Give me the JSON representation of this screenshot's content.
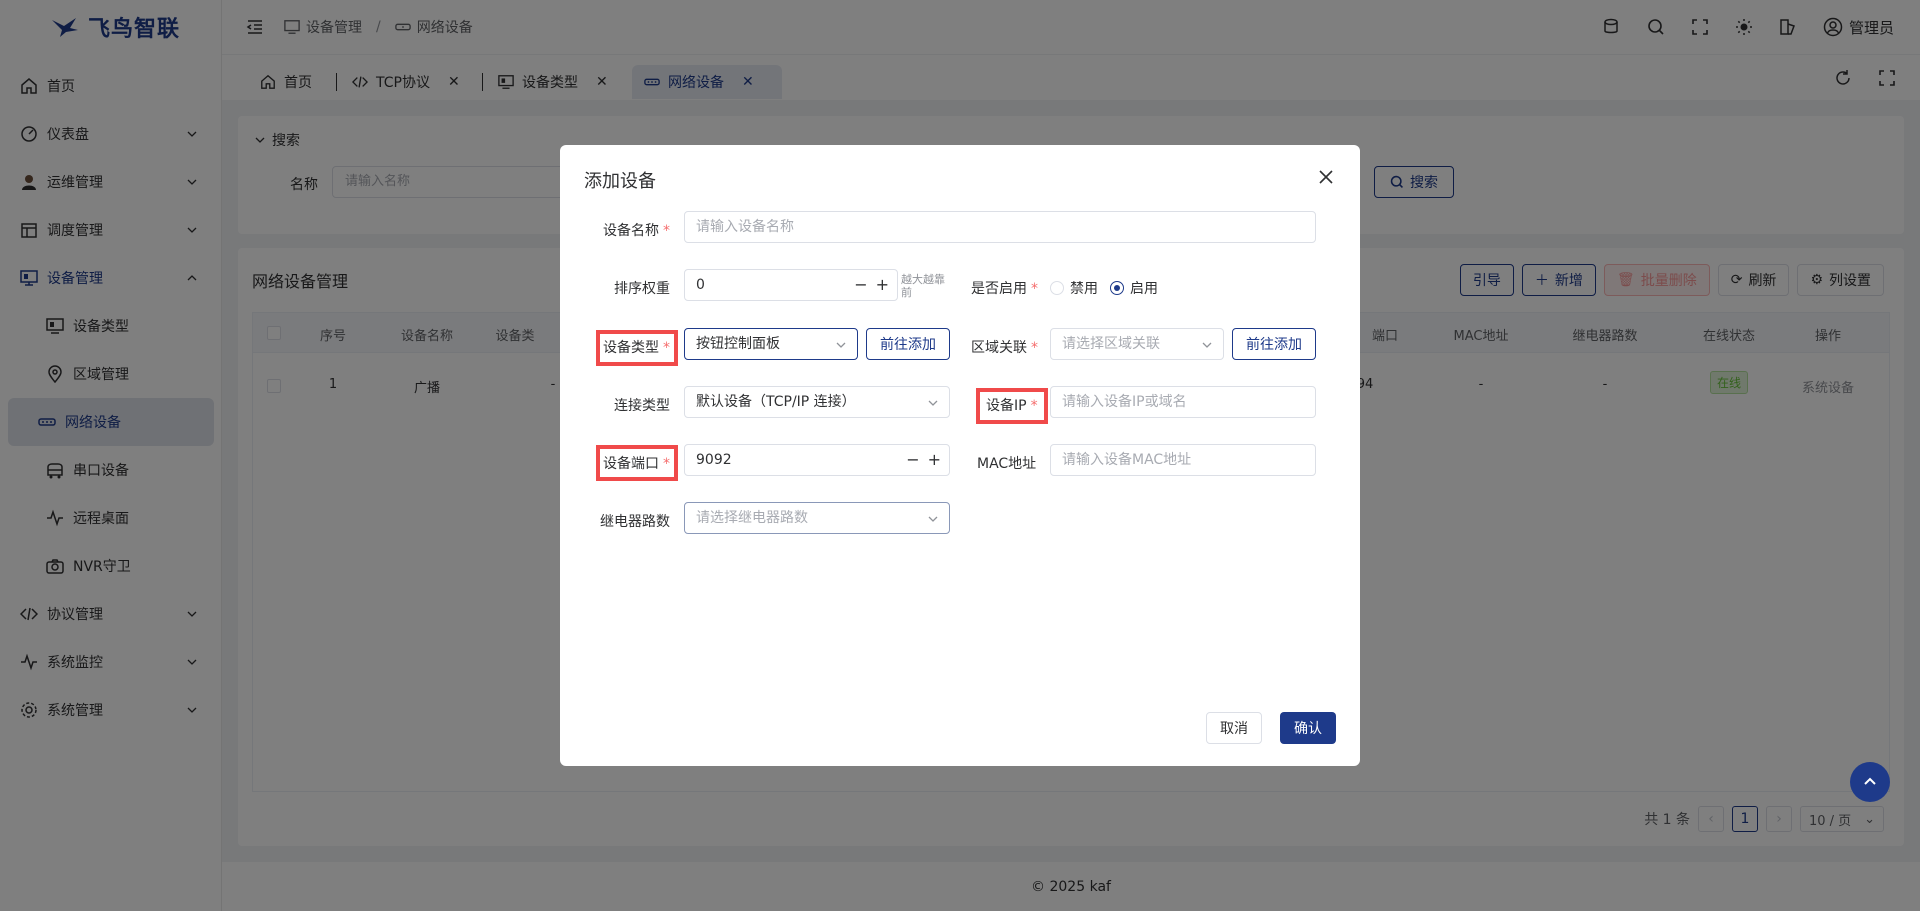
{
  "app": {
    "name": "飞鸟智联"
  },
  "sidebar": {
    "items": [
      {
        "label": "首页",
        "icon": "home-icon"
      },
      {
        "label": "仪表盘",
        "icon": "dashboard-icon"
      },
      {
        "label": "运维管理",
        "icon": "user-icon"
      },
      {
        "label": "调度管理",
        "icon": "calendar-icon"
      },
      {
        "label": "设备管理",
        "icon": "monitor-icon"
      },
      {
        "label": "协议管理",
        "icon": "code-icon"
      },
      {
        "label": "系统监控",
        "icon": "pulse-icon"
      },
      {
        "label": "系统管理",
        "icon": "gear-icon"
      }
    ],
    "sub_items": [
      {
        "label": "设备类型",
        "icon": "monitor-icon"
      },
      {
        "label": "区域管理",
        "icon": "location-icon"
      },
      {
        "label": "网络设备",
        "icon": "network-icon"
      },
      {
        "label": "串口设备",
        "icon": "serial-icon"
      },
      {
        "label": "远程桌面",
        "icon": "pulse-icon"
      },
      {
        "label": "NVR守卫",
        "icon": "camera-icon"
      }
    ]
  },
  "header": {
    "breadcrumb": [
      "设备管理",
      "网络设备"
    ],
    "user": "管理员"
  },
  "tabs": [
    {
      "label": "首页"
    },
    {
      "label": "TCP协议"
    },
    {
      "label": "设备类型"
    },
    {
      "label": "网络设备"
    }
  ],
  "search": {
    "title": "搜索",
    "name_label": "名称",
    "name_placeholder": "请输入名称",
    "button": "搜索"
  },
  "table": {
    "title": "网络设备管理",
    "buttons": {
      "guide": "引导",
      "add": "新增",
      "batch_delete": "批量删除",
      "refresh": "刷新",
      "columns": "列设置"
    },
    "columns": [
      "序号",
      "设备名称",
      "设备类",
      "端口",
      "MAC地址",
      "继电器路数",
      "在线状态",
      "操作"
    ],
    "rows": [
      {
        "index": "1",
        "name": "广播",
        "type": "-",
        "port": "94",
        "mac": "-",
        "relay": "-",
        "status": "在线",
        "action": "系统设备"
      }
    ],
    "pager": {
      "total": "共 1 条",
      "current": "1",
      "page_size": "10 / 页"
    }
  },
  "footer": "© 2025 kaf",
  "dialog": {
    "title": "添加设备",
    "fields": {
      "device_name": {
        "label": "设备名称",
        "placeholder": "请输入设备名称"
      },
      "sort": {
        "label": "排序权重",
        "value": "0",
        "hint": "越大越靠前"
      },
      "enabled": {
        "label": "是否启用",
        "off": "禁用",
        "on": "启用",
        "selected": "启用"
      },
      "device_type": {
        "label": "设备类型",
        "value": "按钮控制面板",
        "goto": "前往添加"
      },
      "area": {
        "label": "区域关联",
        "placeholder": "请选择区域关联",
        "goto": "前往添加"
      },
      "conn_type": {
        "label": "连接类型",
        "value": "默认设备（TCP/IP 连接）"
      },
      "device_ip": {
        "label": "设备IP",
        "placeholder": "请输入设备IP或域名"
      },
      "device_port": {
        "label": "设备端口",
        "value": "9092"
      },
      "mac": {
        "label": "MAC地址",
        "placeholder": "请输入设备MAC地址"
      },
      "relay": {
        "label": "继电器路数",
        "placeholder": "请选择继电器路数"
      }
    },
    "cancel": "取消",
    "confirm": "确认"
  },
  "colors": {
    "primary": "#1e3a8a",
    "danger": "#f56c6c",
    "highlight": "#f04a4a",
    "success": "#67c23a"
  }
}
